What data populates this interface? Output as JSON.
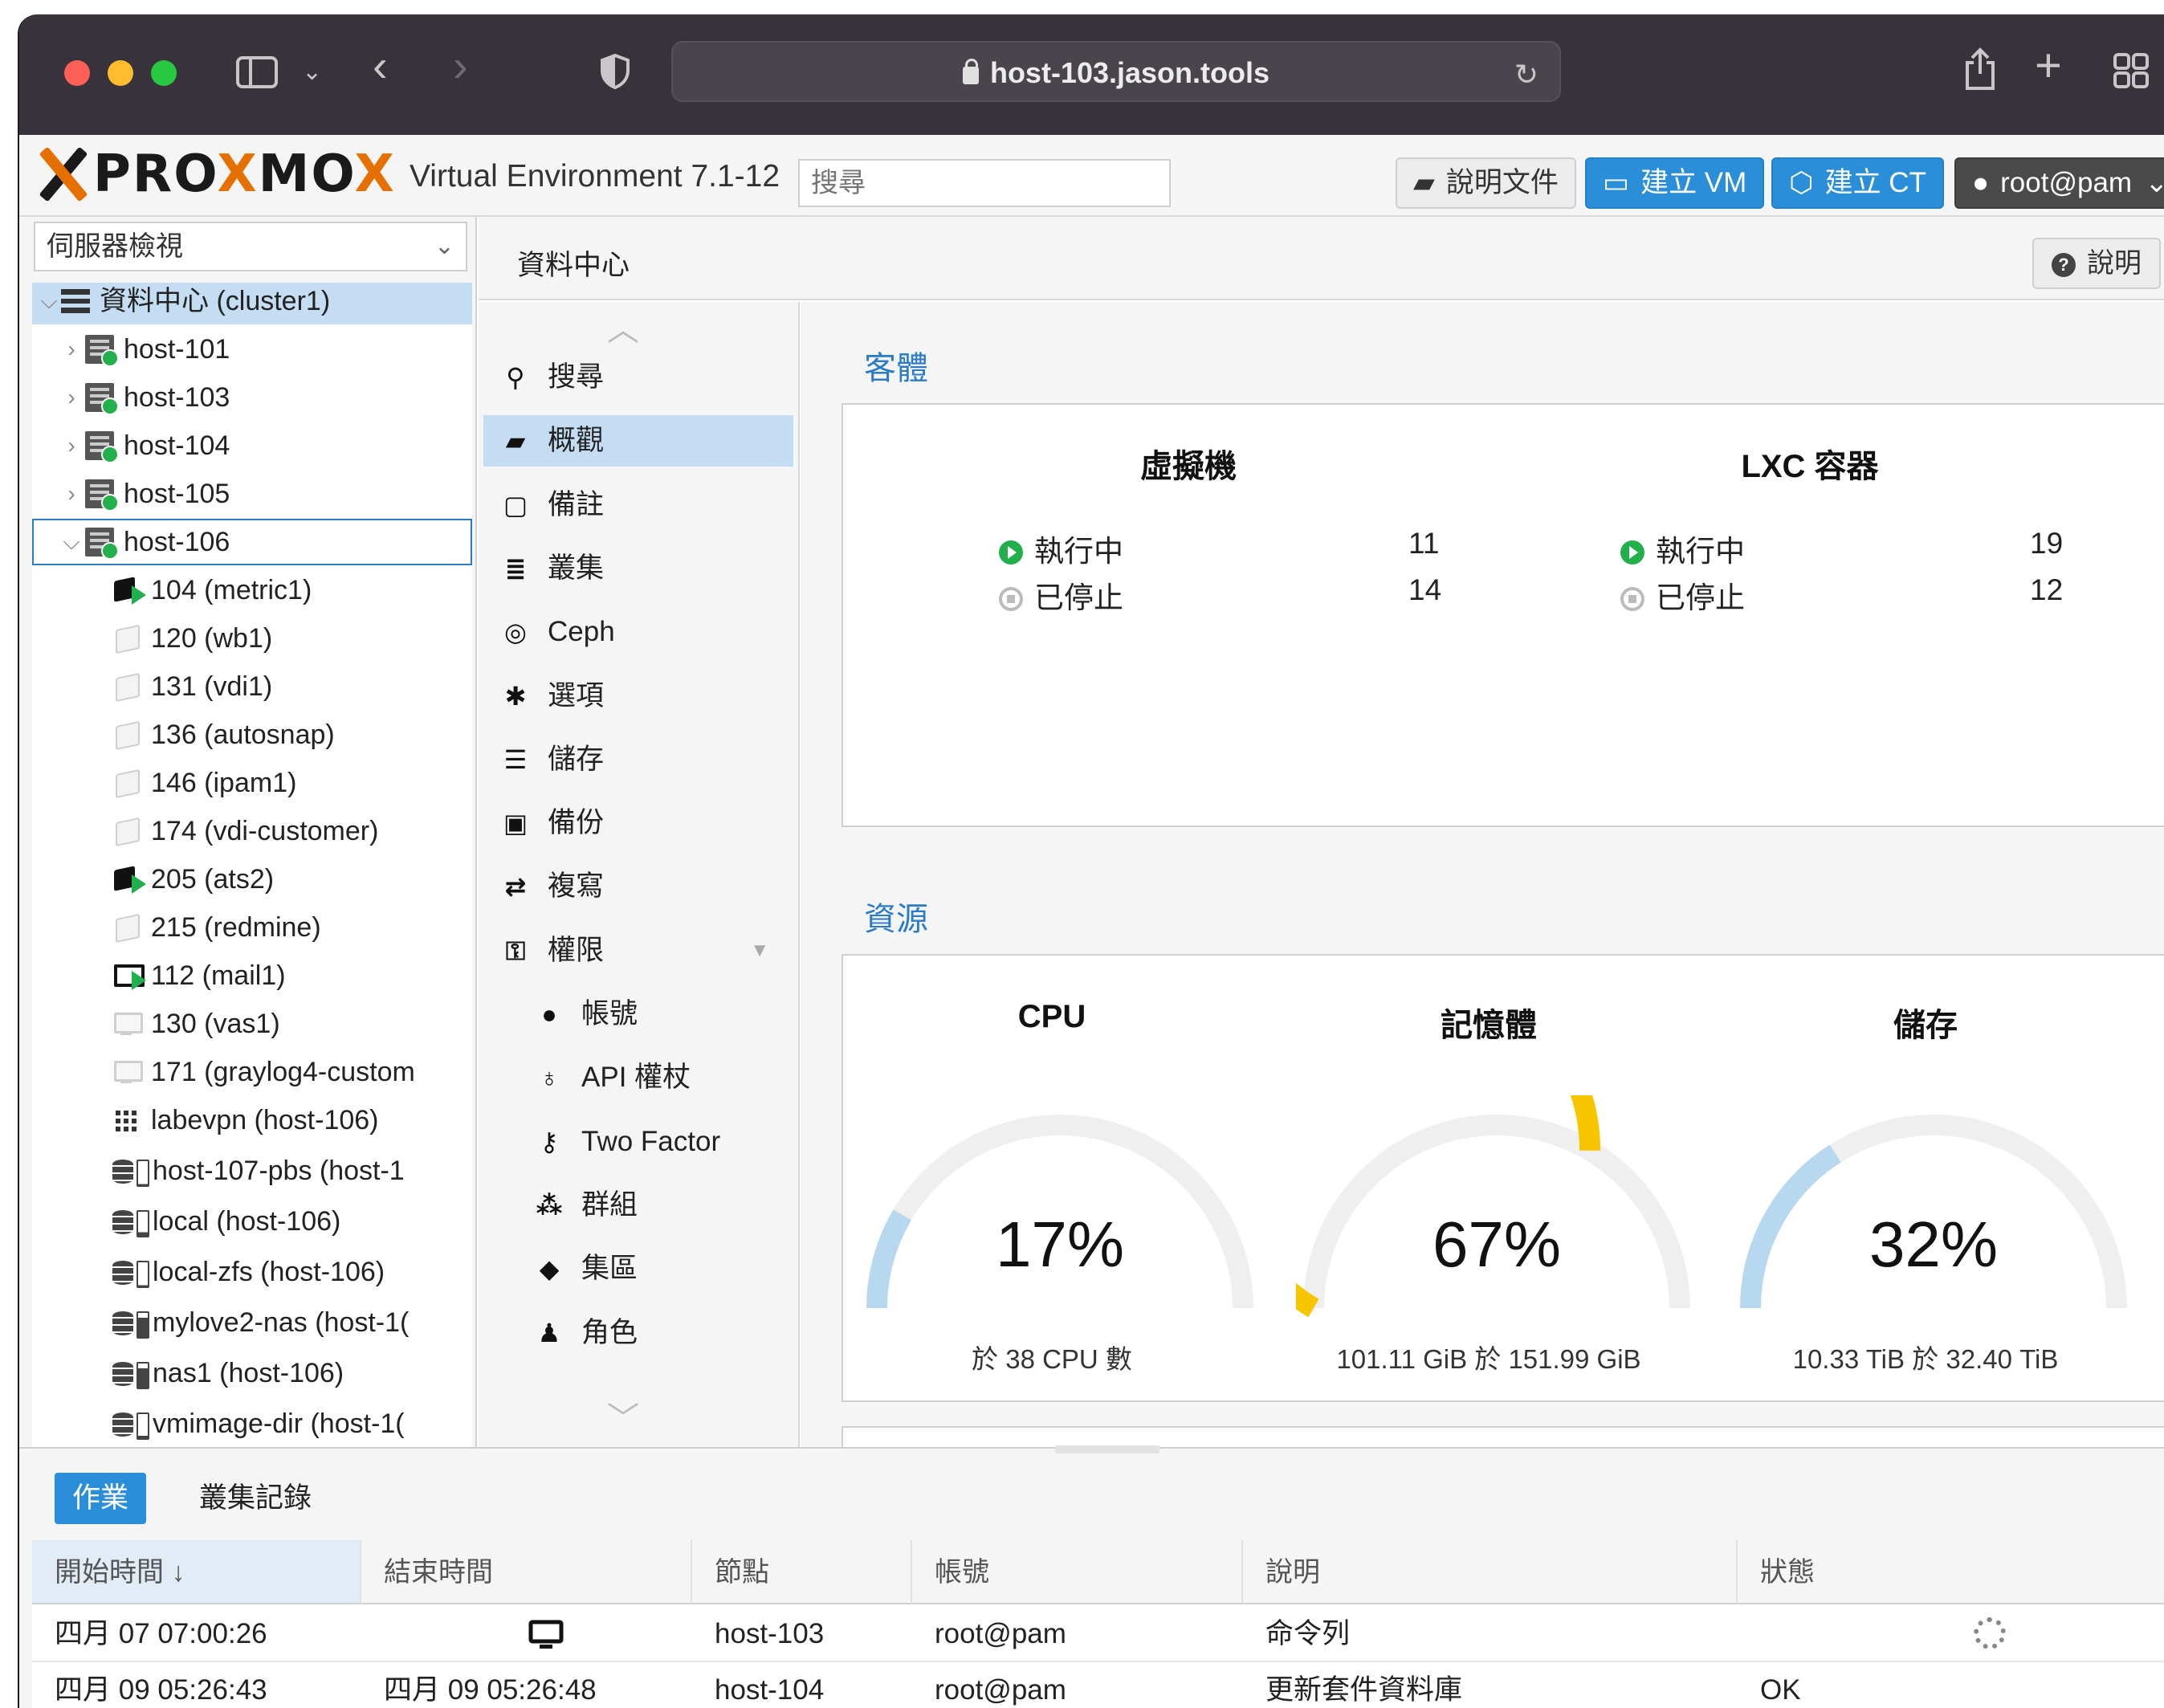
{
  "browser": {
    "url": "host-103.jason.tools",
    "traffic_lights": [
      "#fe5f57",
      "#febc2e",
      "#28c840"
    ]
  },
  "header": {
    "logo_text": "PROXMOX",
    "version": "Virtual Environment 7.1-12",
    "search_placeholder": "搜尋",
    "docs_label": "說明文件",
    "create_vm_label": "建立 VM",
    "create_ct_label": "建立 CT",
    "user_label": "root@pam"
  },
  "sidebar": {
    "view_select": "伺服器檢視",
    "tree": [
      {
        "label": "資料中心 (cluster1)",
        "type": "datacenter",
        "level": 0,
        "expanded": true,
        "selected": true
      },
      {
        "label": "host-101",
        "type": "host",
        "level": 1,
        "expanded": false
      },
      {
        "label": "host-103",
        "type": "host",
        "level": 1,
        "expanded": false
      },
      {
        "label": "host-104",
        "type": "host",
        "level": 1,
        "expanded": false
      },
      {
        "label": "host-105",
        "type": "host",
        "level": 1,
        "expanded": false
      },
      {
        "label": "host-106",
        "type": "host",
        "level": 1,
        "expanded": true,
        "focused": true
      },
      {
        "label": "104 (metric1)",
        "type": "ct-running",
        "level": 2
      },
      {
        "label": "120 (wb1)",
        "type": "ct-stopped",
        "level": 2
      },
      {
        "label": "131 (vdi1)",
        "type": "ct-stopped",
        "level": 2
      },
      {
        "label": "136 (autosnap)",
        "type": "ct-stopped",
        "level": 2
      },
      {
        "label": "146 (ipam1)",
        "type": "ct-stopped",
        "level": 2
      },
      {
        "label": "174 (vdi-customer)",
        "type": "ct-stopped",
        "level": 2
      },
      {
        "label": "205 (ats2)",
        "type": "ct-running",
        "level": 2
      },
      {
        "label": "215 (redmine)",
        "type": "ct-stopped",
        "level": 2
      },
      {
        "label": "112 (mail1)",
        "type": "vm-running",
        "level": 2
      },
      {
        "label": "130 (vas1)",
        "type": "vm-stopped",
        "level": 2
      },
      {
        "label": "171 (graylog4-custom",
        "type": "vm-stopped",
        "level": 2
      },
      {
        "label": "labevpn (host-106)",
        "type": "sdn",
        "level": 2
      },
      {
        "label": "host-107-pbs (host-1",
        "type": "storage",
        "level": 2,
        "fill": 0.05
      },
      {
        "label": "local (host-106)",
        "type": "storage",
        "level": 2,
        "fill": 0.15
      },
      {
        "label": "local-zfs (host-106)",
        "type": "storage",
        "level": 2,
        "fill": 0.05
      },
      {
        "label": "mylove2-nas (host-1(",
        "type": "storage",
        "level": 2,
        "fill": 0.8
      },
      {
        "label": "nas1 (host-106)",
        "type": "storage",
        "level": 2,
        "fill": 0.8
      },
      {
        "label": "vmimage-dir (host-1(",
        "type": "storage",
        "level": 2,
        "fill": 0.1
      }
    ]
  },
  "content": {
    "title": "資料中心",
    "help_label": "說明"
  },
  "menu": {
    "items": [
      {
        "label": "搜尋",
        "icon": "search-icon",
        "glyph": "⚲"
      },
      {
        "label": "概觀",
        "icon": "book-icon",
        "glyph": "▰",
        "selected": true
      },
      {
        "label": "備註",
        "icon": "note-icon",
        "glyph": "▢"
      },
      {
        "label": "叢集",
        "icon": "server-icon",
        "glyph": "≣"
      },
      {
        "label": "Ceph",
        "icon": "ceph-icon",
        "glyph": "◎"
      },
      {
        "label": "選項",
        "icon": "gear-icon",
        "glyph": "✱"
      },
      {
        "label": "儲存",
        "icon": "database-icon",
        "glyph": "☰"
      },
      {
        "label": "備份",
        "icon": "floppy-icon",
        "glyph": "▣"
      },
      {
        "label": "複寫",
        "icon": "retweet-icon",
        "glyph": "⇄"
      },
      {
        "label": "權限",
        "icon": "unlock-icon",
        "glyph": "⚿",
        "has_caret": true
      },
      {
        "label": "帳號",
        "icon": "user-icon",
        "glyph": "●",
        "sub": true
      },
      {
        "label": "API 權杖",
        "icon": "api-user-icon",
        "glyph": "♁",
        "sub": true
      },
      {
        "label": "Two Factor",
        "icon": "key-icon",
        "glyph": "⚷",
        "sub": true
      },
      {
        "label": "群組",
        "icon": "users-icon",
        "glyph": "⁂",
        "sub": true
      },
      {
        "label": "集區",
        "icon": "tags-icon",
        "glyph": "◆",
        "sub": true
      },
      {
        "label": "角色",
        "icon": "male-icon",
        "glyph": "♟",
        "sub": true
      }
    ]
  },
  "guests": {
    "section_title": "客體",
    "vm": {
      "title": "虛擬機",
      "running_label": "執行中",
      "running": "11",
      "stopped_label": "已停止",
      "stopped": "14"
    },
    "lxc": {
      "title": "LXC 容器",
      "running_label": "執行中",
      "running": "19",
      "stopped_label": "已停止",
      "stopped": "12"
    }
  },
  "resources": {
    "section_title": "資源",
    "gauges": [
      {
        "title": "CPU",
        "value": 0.17,
        "value_text": "17%",
        "subtitle": "於 38 CPU 數",
        "color": "#b8d8ef"
      },
      {
        "title": "記憶體",
        "value": 0.67,
        "value_text": "67%",
        "subtitle": "101.11 GiB 於 151.99 GiB",
        "color": "#f7c600"
      },
      {
        "title": "儲存",
        "value": 0.32,
        "value_text": "32%",
        "subtitle": "10.33 TiB 於 32.40 TiB",
        "color": "#b8d8ef"
      }
    ],
    "track_color": "#efefef"
  },
  "tasks": {
    "tabs": [
      "作業",
      "叢集記錄"
    ],
    "columns": [
      "開始時間 ↓",
      "結束時間",
      "節點",
      "帳號",
      "說明",
      "狀態"
    ],
    "rows": [
      {
        "start": "四月 07 07:00:26",
        "end": "",
        "end_icon": "console-icon",
        "node": "host-103",
        "user": "root@pam",
        "desc": "命令列",
        "status": "",
        "status_icon": "spinner-icon"
      },
      {
        "start": "四月 09 05:26:43",
        "end": "四月 09 05:26:48",
        "node": "host-104",
        "user": "root@pam",
        "desc": "更新套件資料庫",
        "status": "OK"
      }
    ]
  }
}
